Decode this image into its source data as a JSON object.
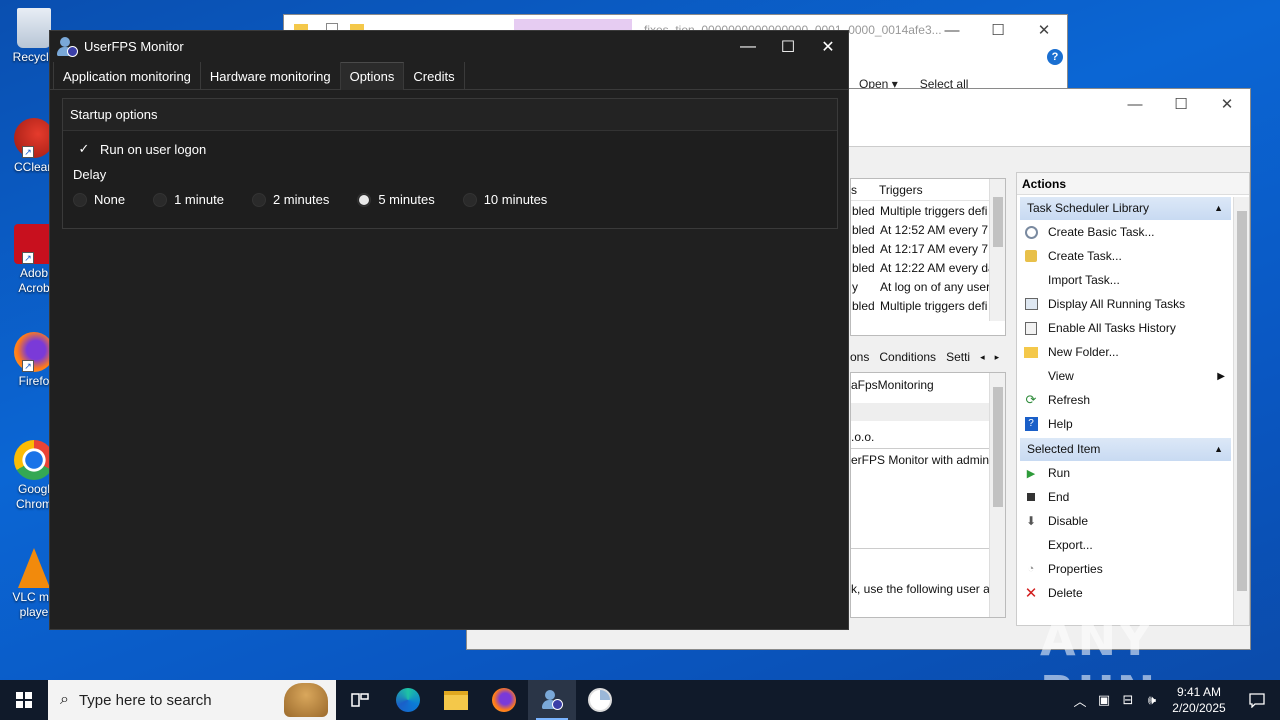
{
  "desktop": {
    "icons": [
      {
        "label": "Recycle",
        "icon": "recycle-bin-icon"
      },
      {
        "label": "CClean",
        "icon": "ccleaner-icon"
      },
      {
        "label": "Adob… Acrob",
        "line1": "Adob",
        "line2": "Acrob",
        "icon": "adobe-acrobat-icon"
      },
      {
        "label": "Firefo",
        "icon": "firefox-icon"
      },
      {
        "label": "Googl Chrom",
        "line1": "Googl",
        "line2": "Chrom",
        "icon": "chrome-icon"
      },
      {
        "label": "VLC me playe",
        "line1": "VLC me",
        "line2": "playe",
        "icon": "vlc-icon"
      }
    ]
  },
  "explorer": {
    "path": "fixes_tjon_0000000000000000_0001_0000_0014afe3...",
    "ribbon": {
      "open": "Open ▾",
      "select_all": "Select all"
    }
  },
  "task_scheduler": {
    "task_list": {
      "col_status_partial": "s",
      "col_triggers": "Triggers",
      "rows": [
        {
          "status": "bled",
          "triggers": "Multiple triggers defi"
        },
        {
          "status": "bled",
          "triggers": "At 12:52 AM every 7"
        },
        {
          "status": "bled",
          "triggers": "At 12:17 AM every 7"
        },
        {
          "status": "bled",
          "triggers": "At 12:22 AM every da"
        },
        {
          "status": "y",
          "triggers": "At log on of any user"
        },
        {
          "status": "bled",
          "triggers": "Multiple triggers defi"
        }
      ]
    },
    "detail_tabs": [
      "ons",
      "Conditions",
      "Setti"
    ],
    "details": {
      "name": "aFpsMonitoring",
      "author": ".o.o.",
      "description": "erFPS Monitor with admin",
      "security": "k, use the following user a"
    },
    "actions": {
      "header": "Actions",
      "library_section": "Task Scheduler Library",
      "library_items": [
        {
          "label": "Create Basic Task...",
          "icon": "create-basic-task-icon"
        },
        {
          "label": "Create Task...",
          "icon": "create-task-icon"
        },
        {
          "label": "Import Task...",
          "icon": ""
        },
        {
          "label": "Display All Running Tasks",
          "icon": "running-tasks-icon"
        },
        {
          "label": "Enable All Tasks History",
          "icon": "history-icon"
        },
        {
          "label": "New Folder...",
          "icon": "folder-icon"
        },
        {
          "label": "View",
          "icon": "",
          "submenu": true
        },
        {
          "label": "Refresh",
          "icon": "refresh-icon"
        },
        {
          "label": "Help",
          "icon": "help-icon"
        }
      ],
      "selected_section": "Selected Item",
      "selected_items": [
        {
          "label": "Run",
          "icon": "run-icon"
        },
        {
          "label": "End",
          "icon": "end-icon"
        },
        {
          "label": "Disable",
          "icon": "disable-icon"
        },
        {
          "label": "Export...",
          "icon": ""
        },
        {
          "label": "Properties",
          "icon": "properties-icon"
        },
        {
          "label": "Delete",
          "icon": "delete-icon"
        }
      ]
    }
  },
  "userfps": {
    "title": "UserFPS Monitor",
    "tabs": [
      "Application monitoring",
      "Hardware monitoring",
      "Options",
      "Credits"
    ],
    "active_tab": "Options",
    "startup_group": "Startup options",
    "run_on_logon": {
      "label": "Run on user logon",
      "checked": true
    },
    "delay_label": "Delay",
    "delay_options": [
      "None",
      "1 minute",
      "2 minutes",
      "5 minutes",
      "10 minutes"
    ],
    "delay_selected": "5 minutes"
  },
  "watermark": "ANY RUN",
  "taskbar": {
    "search_placeholder": "Type here to search",
    "time": "9:41 AM",
    "date": "2/20/2025"
  },
  "colors": {
    "desktop_bg": "#0b66d4",
    "fps_bg": "#202020",
    "taskbar_bg": "#101a2a",
    "section_blue": "#c8daf2"
  }
}
